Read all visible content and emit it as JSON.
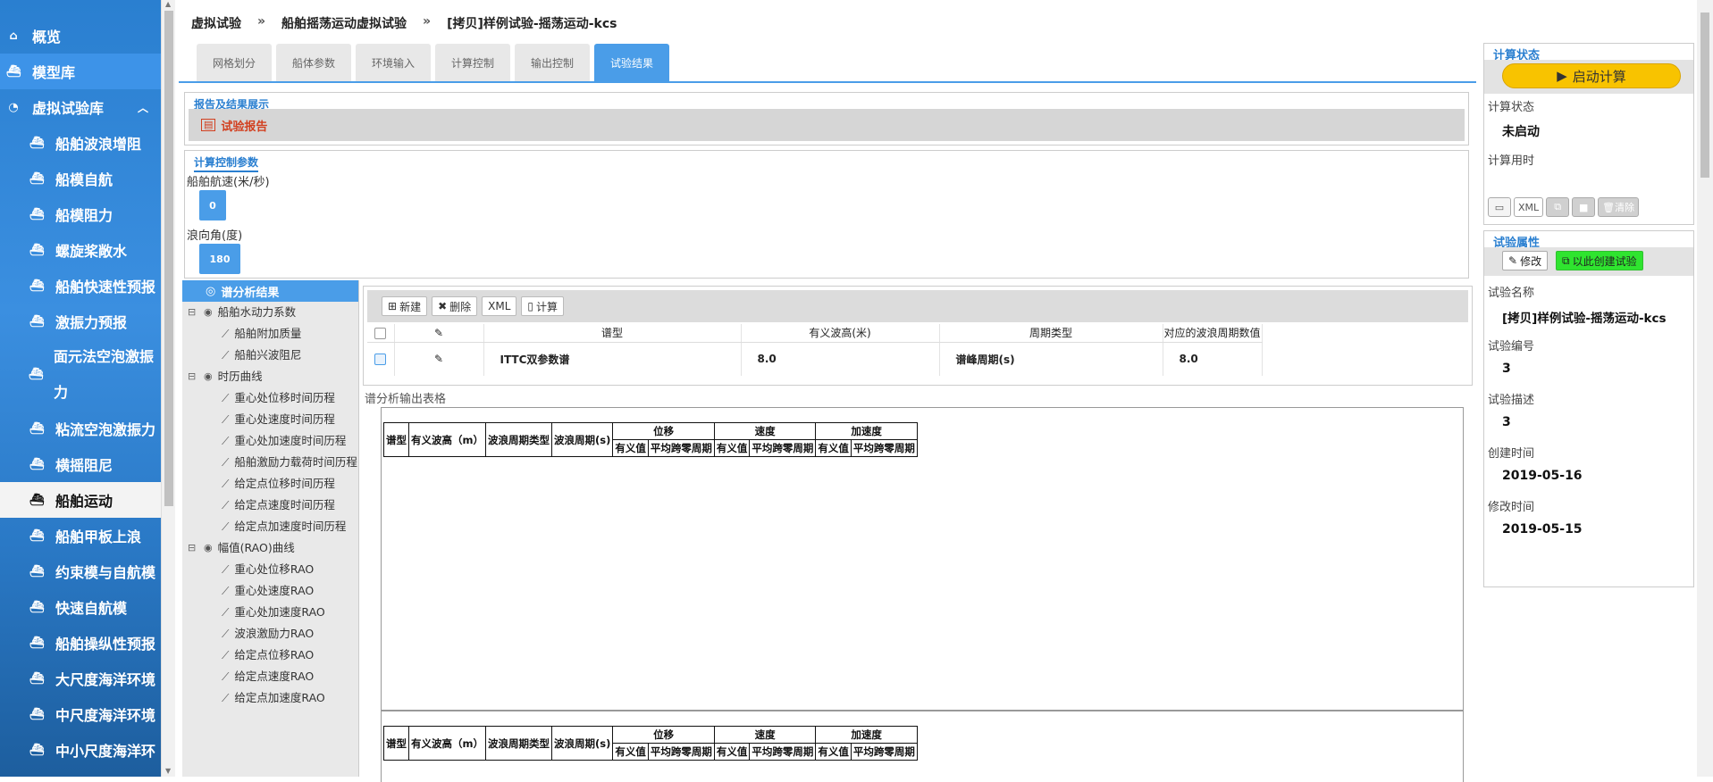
{
  "sidebar": {
    "items": [
      {
        "label": "概览",
        "icon": "home-icon"
      },
      {
        "label": "模型库",
        "icon": "ship-icon"
      },
      {
        "label": "虚拟试验库",
        "icon": "dashboard-icon"
      },
      {
        "label": "船舶波浪增阻",
        "icon": "ship-icon"
      },
      {
        "label": "船模自航",
        "icon": "ship-icon"
      },
      {
        "label": "船模阻力",
        "icon": "ship-icon"
      },
      {
        "label": "螺旋桨敞水",
        "icon": "ship-icon"
      },
      {
        "label": "船舶快速性预报",
        "icon": "ship-icon"
      },
      {
        "label": "激振力预报",
        "icon": "ship-icon"
      },
      {
        "label": "面元法空泡激振力",
        "icon": "ship-icon"
      },
      {
        "label": "粘流空泡激振力",
        "icon": "ship-icon"
      },
      {
        "label": "横摇阻尼",
        "icon": "ship-icon"
      },
      {
        "label": "船舶运动",
        "icon": "ship-icon"
      },
      {
        "label": "船舶甲板上浪",
        "icon": "ship-icon"
      },
      {
        "label": "约束模与自航模",
        "icon": "ship-icon"
      },
      {
        "label": "快速自航模",
        "icon": "ship-icon"
      },
      {
        "label": "船舶操纵性预报",
        "icon": "ship-icon"
      },
      {
        "label": "大尺度海洋环境",
        "icon": "ship-icon"
      },
      {
        "label": "中尺度海洋环境",
        "icon": "ship-icon"
      },
      {
        "label": "中小尺度海洋环",
        "icon": "ship-icon"
      }
    ]
  },
  "breadcrumb": {
    "root": "虚拟试验",
    "sep": "»",
    "level2": "船舶摇荡运动虚拟试验",
    "current": "[拷贝]样例试验-摇荡运动-kcs"
  },
  "tabs": [
    "网格划分",
    "船体参数",
    "环境输入",
    "计算控制",
    "输出控制",
    "试验结果"
  ],
  "report": {
    "title": "报告及结果展示",
    "link": "试验报告"
  },
  "control": {
    "title": "计算控制参数",
    "speed_label": "船舶航速(米/秒)",
    "speed_value": "0",
    "angle_label": "浪向角(度)",
    "angle_value": "180"
  },
  "tree": {
    "head": "谱分析结果",
    "groups": [
      {
        "label": "船舶水动力系数",
        "children": [
          "船舶附加质量",
          "船舶兴波阻尼"
        ]
      },
      {
        "label": "时历曲线",
        "children": [
          "重心处位移时间历程",
          "重心处速度时间历程",
          "重心处加速度时间历程",
          "船舶激励力载荷时间历程",
          "给定点位移时间历程",
          "给定点速度时间历程",
          "给定点加速度时间历程"
        ]
      },
      {
        "label": "幅值(RAO)曲线",
        "children": [
          "重心处位移RAO",
          "重心处速度RAO",
          "重心处加速度RAO",
          "波浪激励力RAO",
          "给定点位移RAO",
          "给定点速度RAO",
          "给定点加速度RAO"
        ]
      }
    ]
  },
  "spectrum": {
    "toolbar": {
      "new": "新建",
      "delete": "删除",
      "xml": "XML",
      "calc": "计算"
    },
    "headers": [
      "谱型",
      "有义波高(米)",
      "周期类型",
      "对应的波浪周期数值"
    ],
    "rows": [
      {
        "type": "ITTC双参数谱",
        "height": "8.0",
        "period_type": "谱峰周期(s)",
        "period": "8.0"
      }
    ]
  },
  "output": {
    "label": "谱分析输出表格",
    "headers": {
      "type": "谱型",
      "height": "有义波高（m）",
      "period_type": "波浪周期类型",
      "period": "波浪周期(s)",
      "disp": "位移",
      "vel": "速度",
      "acc": "加速度",
      "sig": "有义值",
      "avg": "平均跨零周期"
    }
  },
  "status": {
    "title": "计算状态",
    "start": "启动计算",
    "state_label": "计算状态",
    "state_value": "未启动",
    "time_label": "计算用时",
    "time_value": "",
    "tools": {
      "xml": "XML",
      "clear": "清除"
    }
  },
  "props": {
    "title": "试验属性",
    "edit": "修改",
    "create": "以此创建试验",
    "name_label": "试验名称",
    "name_value": "[拷贝]样例试验-摇荡运动-kcs",
    "id_label": "试验编号",
    "id_value": "3",
    "desc_label": "试验描述",
    "desc_value": "3",
    "created_label": "创建时间",
    "created_value": "2019-05-16",
    "modified_label": "修改时间",
    "modified_value": "2019-05-15"
  },
  "colors": {
    "accent": "#4a9de8",
    "start_button": "#f8c300",
    "create_button": "#2fe42f",
    "report_link": "#d23f1f"
  }
}
